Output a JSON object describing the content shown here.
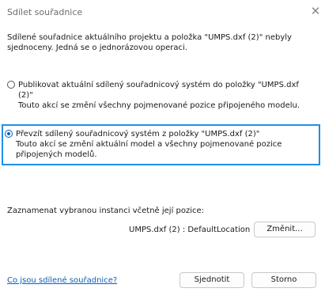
{
  "dialog": {
    "title": "Sdílet souřadnice",
    "close_glyph": "✕",
    "intro": "Sdílené souřadnice aktuálního projektu a položka \"UMPS.dxf (2)\" nebyly sjednoceny. Jedná se o jednorázovou operaci.",
    "options": [
      {
        "label": "Publikovat aktuální sdílený souřadnicový systém do položky \"UMPS.dxf (2)\"",
        "description": "Touto akcí se změní všechny pojmenované pozice připojeného modelu.",
        "selected": false
      },
      {
        "label": "Převzít sdílený souřadnicový systém z položky \"UMPS.dxf (2)\"",
        "description": "Touto akcí se změní aktuální model a všechny pojmenované pozice připojených modelů.",
        "selected": true
      }
    ],
    "record_label": "Zaznamenat vybranou instanci včetně její pozice:",
    "instance_value": "UMPS.dxf (2) : DefaultLocation",
    "change_button": "Změnit...",
    "help_link": "Co jsou sdílené souřadnice?",
    "ok_button": "Sjednotit",
    "cancel_button": "Storno",
    "colors": {
      "accent": "#1e90e6",
      "link": "#0b5fb5",
      "title_text": "#6d6d6d"
    }
  }
}
